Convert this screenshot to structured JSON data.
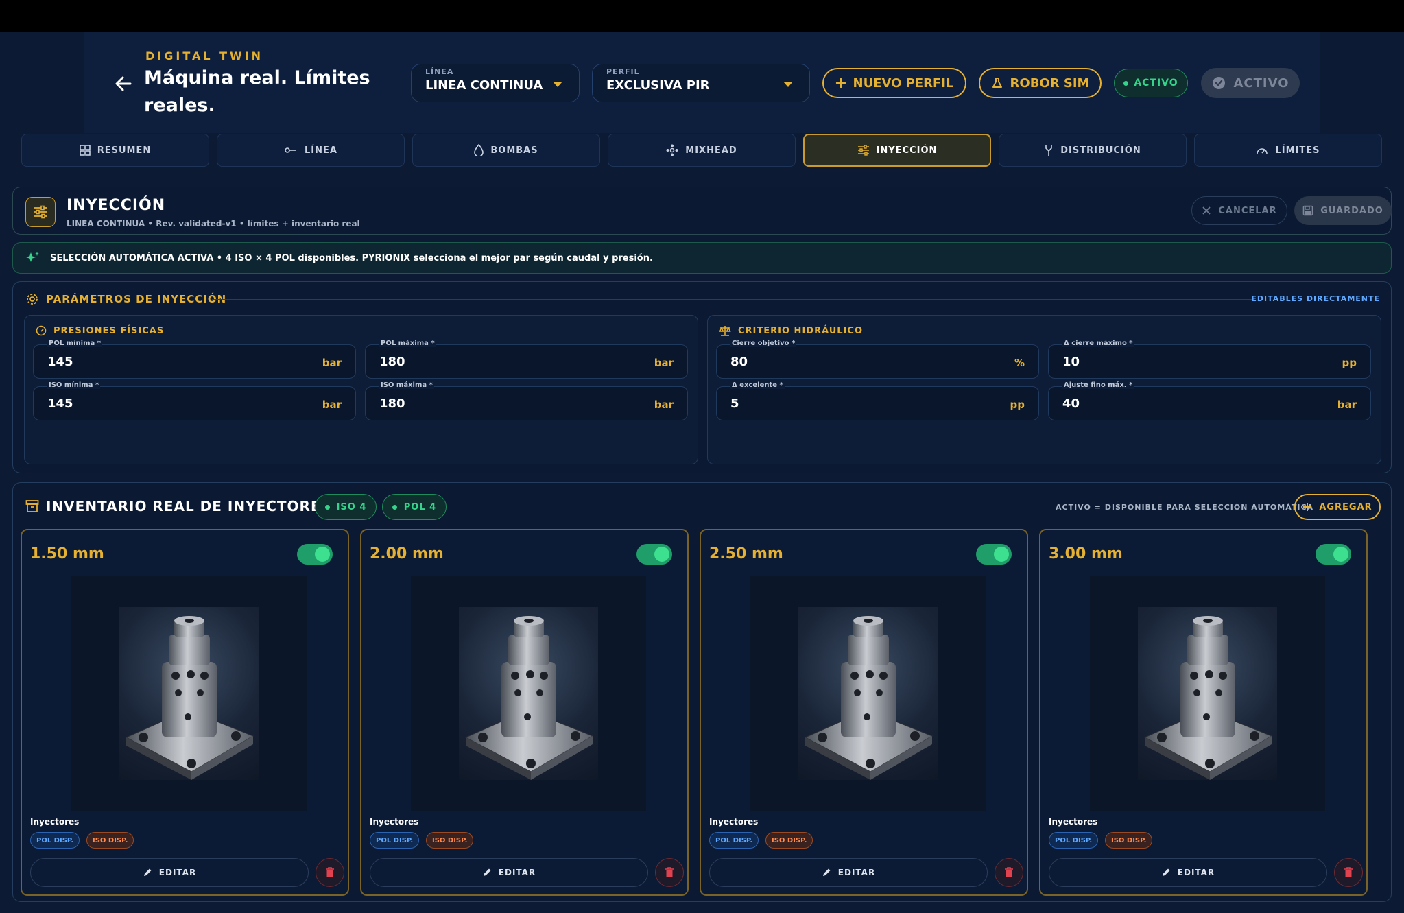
{
  "header": {
    "eyebrow": "DIGITAL TWIN",
    "title": "Máquina real. Límites reales.",
    "line_select": {
      "label": "LÍNEA",
      "value": "LINEA CONTINUA"
    },
    "profile_select": {
      "label": "PERFIL",
      "value": "EXCLUSIVA PIR"
    },
    "new_profile_label": "NUEVO PERFIL",
    "robor_sim_label": "ROBOR SIM",
    "status_badge": "ACTIVO",
    "activo_button": "ACTIVO"
  },
  "tabs": [
    {
      "label": "RESUMEN",
      "icon": "grid-icon"
    },
    {
      "label": "LÍNEA",
      "icon": "line-icon"
    },
    {
      "label": "BOMBAS",
      "icon": "drop-icon"
    },
    {
      "label": "MIXHEAD",
      "icon": "mixhead-icon"
    },
    {
      "label": "INYECCIÓN",
      "icon": "sliders-icon",
      "active": true
    },
    {
      "label": "DISTRIBUCIÓN",
      "icon": "fork-icon"
    },
    {
      "label": "LÍMITES",
      "icon": "gauge-icon"
    }
  ],
  "section": {
    "title": "INYECCIÓN",
    "subtitle": "LINEA CONTINUA • Rev. validated-v1 • límites + inventario real",
    "cancel_label": "CANCELAR",
    "saved_label": "GUARDADO"
  },
  "auto_banner": "SELECCIÓN AUTOMÁTICA ACTIVA • 4 ISO × 4 POL disponibles. PYRIONIX selecciona el mejor par según caudal y presión.",
  "params": {
    "title": "PARÁMETROS DE INYECCIÓN",
    "right_note": "EDITABLES DIRECTAMENTE",
    "pressures": {
      "title": "PRESIONES FÍSICAS",
      "fields": [
        {
          "label": "POL mínima *",
          "value": "145",
          "unit": "bar"
        },
        {
          "label": "POL máxima *",
          "value": "180",
          "unit": "bar"
        },
        {
          "label": "ISO mínima *",
          "value": "145",
          "unit": "bar"
        },
        {
          "label": "ISO máxima *",
          "value": "180",
          "unit": "bar"
        }
      ]
    },
    "hydraulic": {
      "title": "CRITERIO HIDRÁULICO",
      "fields": [
        {
          "label": "Cierre objetivo *",
          "value": "80",
          "unit": "%"
        },
        {
          "label": "Δ cierre máximo *",
          "value": "10",
          "unit": "pp"
        },
        {
          "label": "Δ excelente *",
          "value": "5",
          "unit": "pp"
        },
        {
          "label": "Ajuste fino máx. *",
          "value": "40",
          "unit": "bar"
        }
      ]
    }
  },
  "inventory": {
    "title": "INVENTARIO REAL DE INYECTORES",
    "chip_iso": "ISO 4",
    "chip_pol": "POL 4",
    "note": "ACTIVO = DISPONIBLE PARA SELECCIÓN AUTOMÁTICA",
    "add_label": "AGREGAR",
    "items": [
      {
        "size": "1.50 mm",
        "enabled": true,
        "caption": "Inyectores",
        "tag_pol": "POL DISP.",
        "tag_iso": "ISO DISP.",
        "edit_label": "EDITAR"
      },
      {
        "size": "2.00 mm",
        "enabled": true,
        "caption": "Inyectores",
        "tag_pol": "POL DISP.",
        "tag_iso": "ISO DISP.",
        "edit_label": "EDITAR"
      },
      {
        "size": "2.50 mm",
        "enabled": true,
        "caption": "Inyectores",
        "tag_pol": "POL DISP.",
        "tag_iso": "ISO DISP.",
        "edit_label": "EDITAR"
      },
      {
        "size": "3.00 mm",
        "enabled": true,
        "caption": "Inyectores",
        "tag_pol": "POL DISP.",
        "tag_iso": "ISO DISP.",
        "edit_label": "EDITAR"
      }
    ]
  },
  "colors": {
    "accent": "#e6b030",
    "success": "#35d48a",
    "background": "#0c1a33",
    "info": "#5fa8ff",
    "danger": "#e0434f"
  }
}
